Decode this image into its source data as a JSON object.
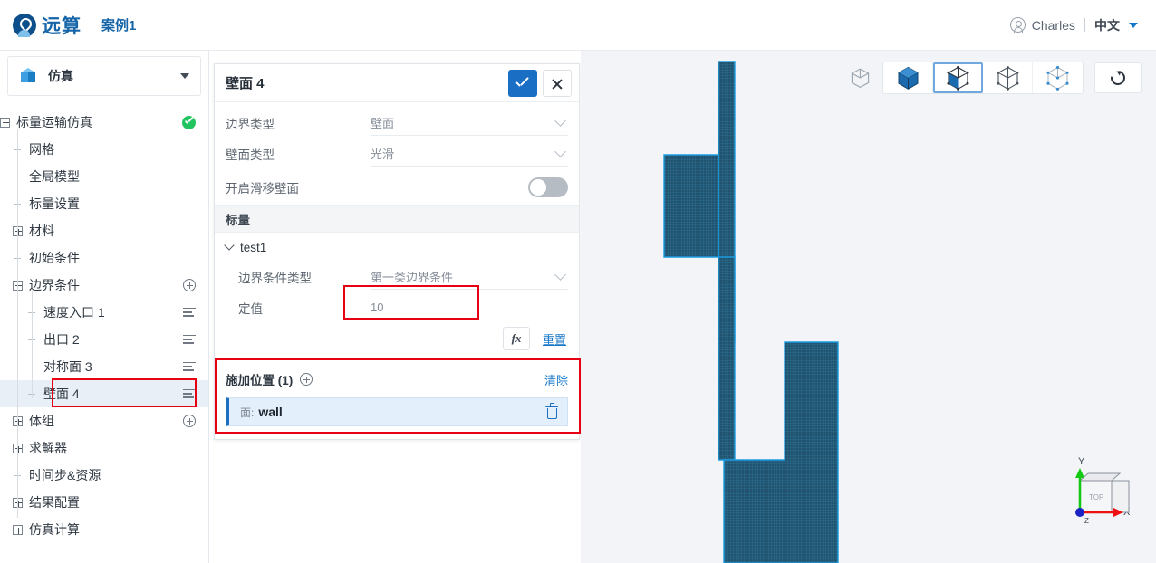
{
  "header": {
    "brand": "远算",
    "case_title": "案例1",
    "user_name": "Charles",
    "language": "中文",
    "icons": {
      "user": "user-circle-icon",
      "caret": "chevron-down-icon"
    }
  },
  "sidebar": {
    "section_title": "仿真",
    "tree": [
      {
        "label": "标量运输仿真",
        "level": 0,
        "expander": "minus",
        "badge": "check-ok"
      },
      {
        "label": "网格",
        "level": 1,
        "expander": "leaf"
      },
      {
        "label": "全局模型",
        "level": 1,
        "expander": "leaf"
      },
      {
        "label": "标量设置",
        "level": 1,
        "expander": "leaf"
      },
      {
        "label": "材料",
        "level": 1,
        "expander": "plus"
      },
      {
        "label": "初始条件",
        "level": 1,
        "expander": "leaf"
      },
      {
        "label": "边界条件",
        "level": 1,
        "expander": "minus",
        "action": "plus-circle"
      },
      {
        "label": "速度入口 1",
        "level": 2,
        "expander": "leaf",
        "action": "list-menu"
      },
      {
        "label": "出口 2",
        "level": 2,
        "expander": "leaf",
        "action": "list-menu"
      },
      {
        "label": "对称面 3",
        "level": 2,
        "expander": "leaf",
        "action": "list-menu"
      },
      {
        "label": "壁面 4",
        "level": 2,
        "expander": "leaf",
        "action": "list-menu",
        "selected": true,
        "highlighted": true
      },
      {
        "label": "体组",
        "level": 1,
        "expander": "plus",
        "action": "plus-circle"
      },
      {
        "label": "求解器",
        "level": 1,
        "expander": "plus"
      },
      {
        "label": "时间步&资源",
        "level": 1,
        "expander": "leaf"
      },
      {
        "label": "结果配置",
        "level": 1,
        "expander": "plus"
      },
      {
        "label": "仿真计算",
        "level": 1,
        "expander": "plus"
      }
    ]
  },
  "panel": {
    "title": "壁面 4",
    "confirm_icon": "check-icon",
    "close_icon": "close-icon",
    "fields": [
      {
        "label": "边界类型",
        "value": "壁面",
        "control": "select"
      },
      {
        "label": "壁面类型",
        "value": "光滑",
        "control": "select"
      }
    ],
    "toggle_row": {
      "label": "开启滑移壁面",
      "state": "off"
    },
    "section_band": "标量",
    "group": {
      "name": "test1",
      "expanded": true
    },
    "group_fields": [
      {
        "label": "边界条件类型",
        "value": "第一类边界条件",
        "control": "select"
      },
      {
        "label": "定值",
        "value": "10",
        "control": "input",
        "highlighted": true
      }
    ],
    "fx_label": "fx",
    "reset_label": "重置",
    "location": {
      "title": "施加位置 (1)",
      "add_icon": "plus-circle-icon",
      "clear_label": "清除",
      "items": [
        {
          "prefix": "面:",
          "name": "wall",
          "delete_icon": "trash-icon"
        }
      ]
    }
  },
  "viewport": {
    "toolbar": [
      {
        "name": "wireframe-cube-standalone",
        "mode": "outline",
        "active": false,
        "grouped": false
      },
      {
        "name": "shaded-cube",
        "mode": "solid",
        "active": false,
        "grouped": true
      },
      {
        "name": "shaded-edges-cube",
        "mode": "half",
        "active": true,
        "grouped": true
      },
      {
        "name": "wireframe-cube",
        "mode": "wire",
        "active": false,
        "grouped": true
      },
      {
        "name": "points-cube",
        "mode": "points",
        "active": false,
        "grouped": true
      },
      {
        "name": "reset-view",
        "mode": "reset",
        "active": false,
        "grouped": false
      }
    ],
    "gizmo": {
      "x_label": "X",
      "y_label": "Y",
      "cube_face": "TOP"
    },
    "mesh": {
      "fill": "#21536f",
      "edge": "#1b9be0",
      "background": "#f2f4f7"
    }
  },
  "colors": {
    "accent": "#1a6fc4",
    "link": "#1677c9",
    "annotation": "#e60012",
    "ok": "#21c560",
    "brand": "#1565a8"
  }
}
